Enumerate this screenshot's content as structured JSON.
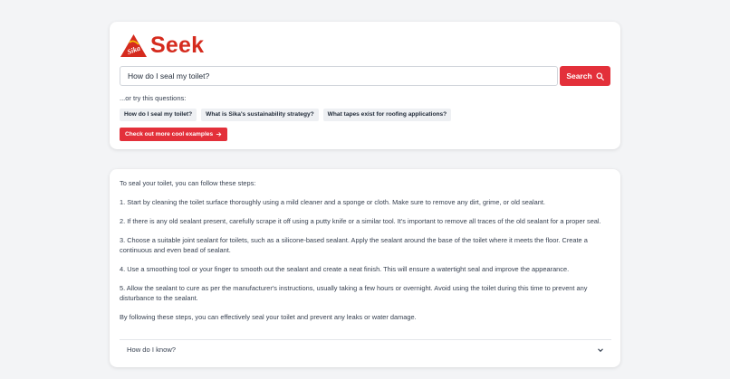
{
  "brand": {
    "name": "Seek",
    "logo_text": "Sika",
    "color": "#d52b1e"
  },
  "search": {
    "value": "How do I seal my toilet?",
    "button_label": "Search",
    "button_icon": "search-icon",
    "accent": "#e3303a"
  },
  "suggestions": {
    "label": "...or try this questions:",
    "items": [
      "How do I seal my toilet?",
      "What is Sika's sustainability strategy?",
      "What tapes exist for roofing applications?"
    ],
    "examples_label": "Check out more cool examples",
    "examples_icon": "arrow-right-icon"
  },
  "answer": {
    "paragraphs": [
      "To seal your toilet, you can follow these steps:",
      "1. Start by cleaning the toilet surface thoroughly using a mild cleaner and a sponge or cloth. Make sure to remove any dirt, grime, or old sealant.",
      "2. If there is any old sealant present, carefully scrape it off using a putty knife or a similar tool. It's important to remove all traces of the old sealant for a proper seal.",
      "3. Choose a suitable joint sealant for toilets, such as a silicone-based sealant. Apply the sealant around the base of the toilet where it meets the floor. Create a continuous and even bead of sealant.",
      "4. Use a smoothing tool or your finger to smooth out the sealant and create a neat finish. This will ensure a watertight seal and improve the appearance.",
      "5. Allow the sealant to cure as per the manufacturer's instructions, usually taking a few hours or overnight. Avoid using the toilet during this time to prevent any disturbance to the sealant.",
      "By following these steps, you can effectively seal your toilet and prevent any leaks or water damage."
    ],
    "accordion_label": "How do I know?",
    "accordion_icon": "chevron-down-icon"
  }
}
